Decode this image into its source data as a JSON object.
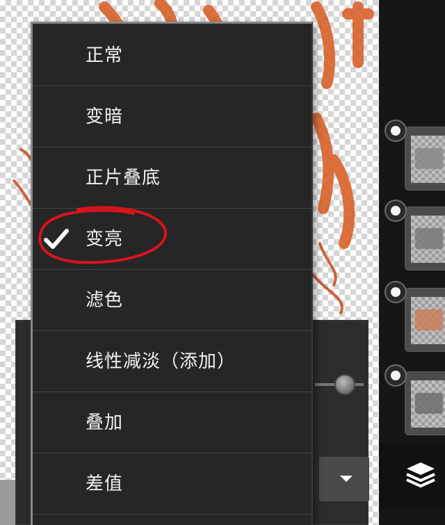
{
  "blend_menu": {
    "items": [
      {
        "label": "正常",
        "selected": false
      },
      {
        "label": "变暗",
        "selected": false
      },
      {
        "label": "正片叠底",
        "selected": false
      },
      {
        "label": "变亮",
        "selected": true
      },
      {
        "label": "滤色",
        "selected": false
      },
      {
        "label": "线性减淡（添加）",
        "selected": false
      },
      {
        "label": "叠加",
        "selected": false
      },
      {
        "label": "差值",
        "selected": false
      }
    ],
    "selected_icon": "checkmark-icon",
    "annotation": "red-circle-highlight"
  },
  "layers_panel": {
    "layers": [
      {
        "name": "layer-1",
        "thumb_color": "#8a8a8a"
      },
      {
        "name": "layer-2",
        "thumb_color": "#7a7a7a"
      },
      {
        "name": "layer-3",
        "thumb_color": "#c9805a"
      },
      {
        "name": "layer-4",
        "thumb_color": "#6e6e6e"
      }
    ],
    "toggle_icon": "layers-stack-icon"
  },
  "properties_panel": {
    "opacity_slider_icon": "slider-thumb",
    "dropdown_icon": "triangle-down-icon"
  },
  "colors": {
    "menu_bg": "#262626",
    "menu_text": "#f2f2f2",
    "annotation_red": "#d9141c",
    "artwork_orange": "#d9622a"
  }
}
